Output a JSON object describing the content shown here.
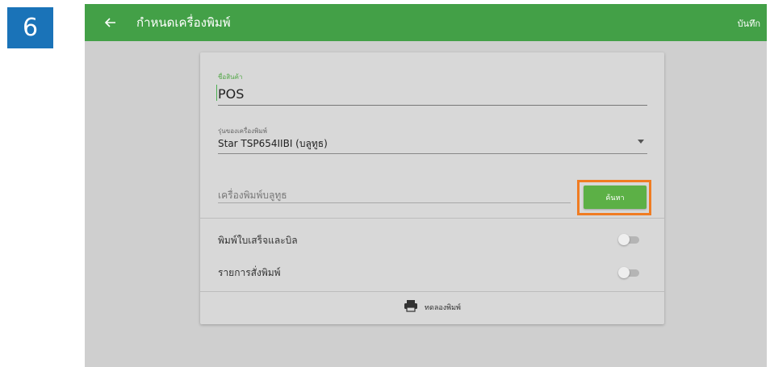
{
  "step": {
    "number": "6"
  },
  "appbar": {
    "title": "กำหนดเครื่องพิมพ์",
    "save_label": "บันทึก",
    "icons": {
      "back": "arrow-left-icon"
    },
    "color": "#43a047"
  },
  "form": {
    "product_name": {
      "label": "ชื่อสินค้า",
      "value": "POS"
    },
    "printer_model": {
      "label": "รุ่นของเครื่องพิมพ์",
      "value": "Star TSP654IIBI (บลูทูธ)"
    },
    "bluetooth_printer": {
      "placeholder": "เครื่องพิมพ์บลูทูธ",
      "search_label": "ค้นหา"
    },
    "toggles": [
      {
        "label": "พิมพ์ใบเสร็จและบิล",
        "on": false
      },
      {
        "label": "รายการสั่งพิมพ์",
        "on": false
      }
    ],
    "test_print": {
      "label": "ทดลองพิมพ์",
      "icon": "printer-icon"
    }
  },
  "colors": {
    "accent": "#5cb046",
    "highlight": "#f07c22",
    "badge": "#1a73b8"
  }
}
